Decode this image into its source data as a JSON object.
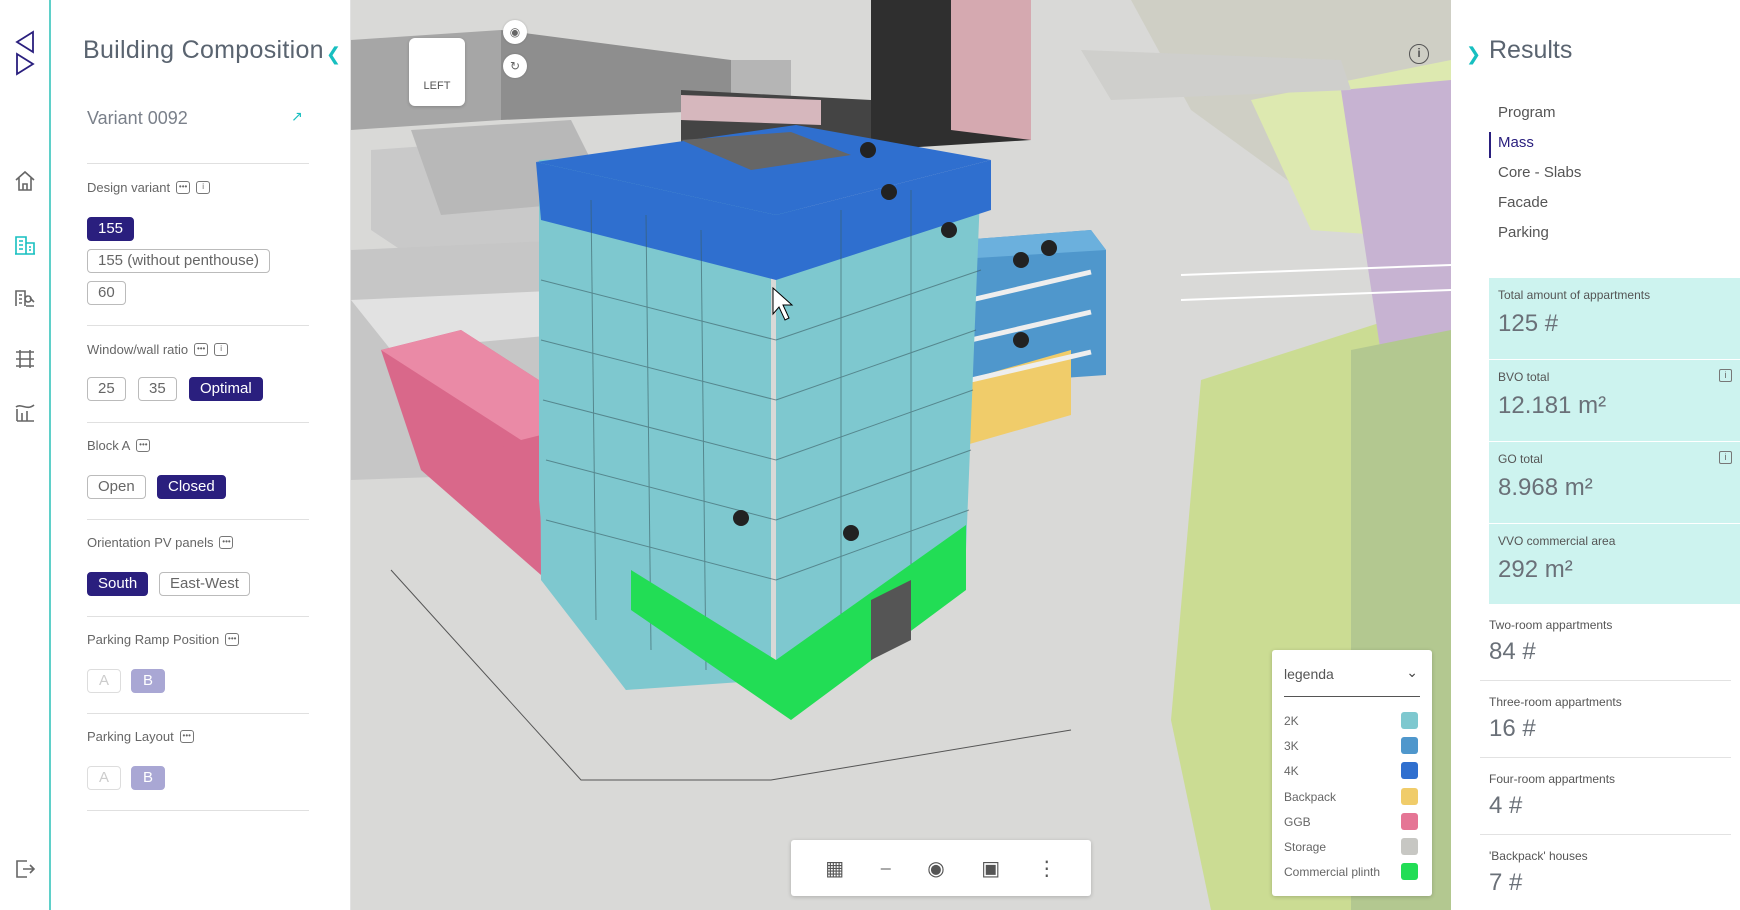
{
  "left_panel": {
    "title": "Building Composition",
    "variant_name": "Variant 0092",
    "groups": [
      {
        "label": "Design variant",
        "options": [
          "155",
          "155 (without penthouse)",
          "60"
        ],
        "selected": "155"
      },
      {
        "label": "Window/wall ratio",
        "options": [
          "25",
          "35",
          "Optimal"
        ],
        "selected": "Optimal"
      },
      {
        "label": "Block A",
        "options": [
          "Open",
          "Closed"
        ],
        "selected": "Closed"
      },
      {
        "label": "Orientation PV panels",
        "options": [
          "South",
          "East-West"
        ],
        "selected": "South"
      },
      {
        "label": "Parking Ramp Position",
        "options": [
          "A",
          "B"
        ],
        "selected": "B",
        "disabled": true
      },
      {
        "label": "Parking Layout",
        "options": [
          "A",
          "B"
        ],
        "selected": "B",
        "disabled": true
      }
    ]
  },
  "viewport": {
    "view_cube_label": "LEFT",
    "legend": {
      "title": "legenda",
      "items": [
        {
          "label": "2K",
          "color": "#7ec8cf"
        },
        {
          "label": "3K",
          "color": "#4f97cc"
        },
        {
          "label": "4K",
          "color": "#2f6fcf"
        },
        {
          "label": "Backpack",
          "color": "#f0cc6a"
        },
        {
          "label": "GGB",
          "color": "#e57595"
        },
        {
          "label": "Storage",
          "color": "#c7c7c3"
        },
        {
          "label": "Commercial plinth",
          "color": "#22dd55"
        }
      ]
    },
    "toolbar_icons": [
      "layout-icon",
      "ruler-icon",
      "eye-comment-icon",
      "buildings-icon",
      "more-vertical-icon"
    ]
  },
  "right_panel": {
    "title": "Results",
    "nav": [
      "Program",
      "Mass",
      "Core - Slabs",
      "Facade",
      "Parking"
    ],
    "active_nav": "Mass",
    "highlighted_metrics": [
      {
        "label": "Total amount of appartments",
        "value": "125 #",
        "info": false
      },
      {
        "label": "BVO total",
        "value": "12.181 m²",
        "info": true
      },
      {
        "label": "GO total",
        "value": "8.968 m²",
        "info": true
      },
      {
        "label": "VVO commercial area",
        "value": "292 m²",
        "info": false
      }
    ],
    "metrics": [
      {
        "label": "Two-room appartments",
        "value": "84 #"
      },
      {
        "label": "Three-room appartments",
        "value": "16 #"
      },
      {
        "label": "Four-room appartments",
        "value": "4 #"
      },
      {
        "label": "'Backpack' houses",
        "value": "7 #"
      }
    ]
  },
  "colors": {
    "accent": "#17bfc0",
    "selected": "#2a1f7e",
    "highlight_bg": "#cdf3ef"
  }
}
